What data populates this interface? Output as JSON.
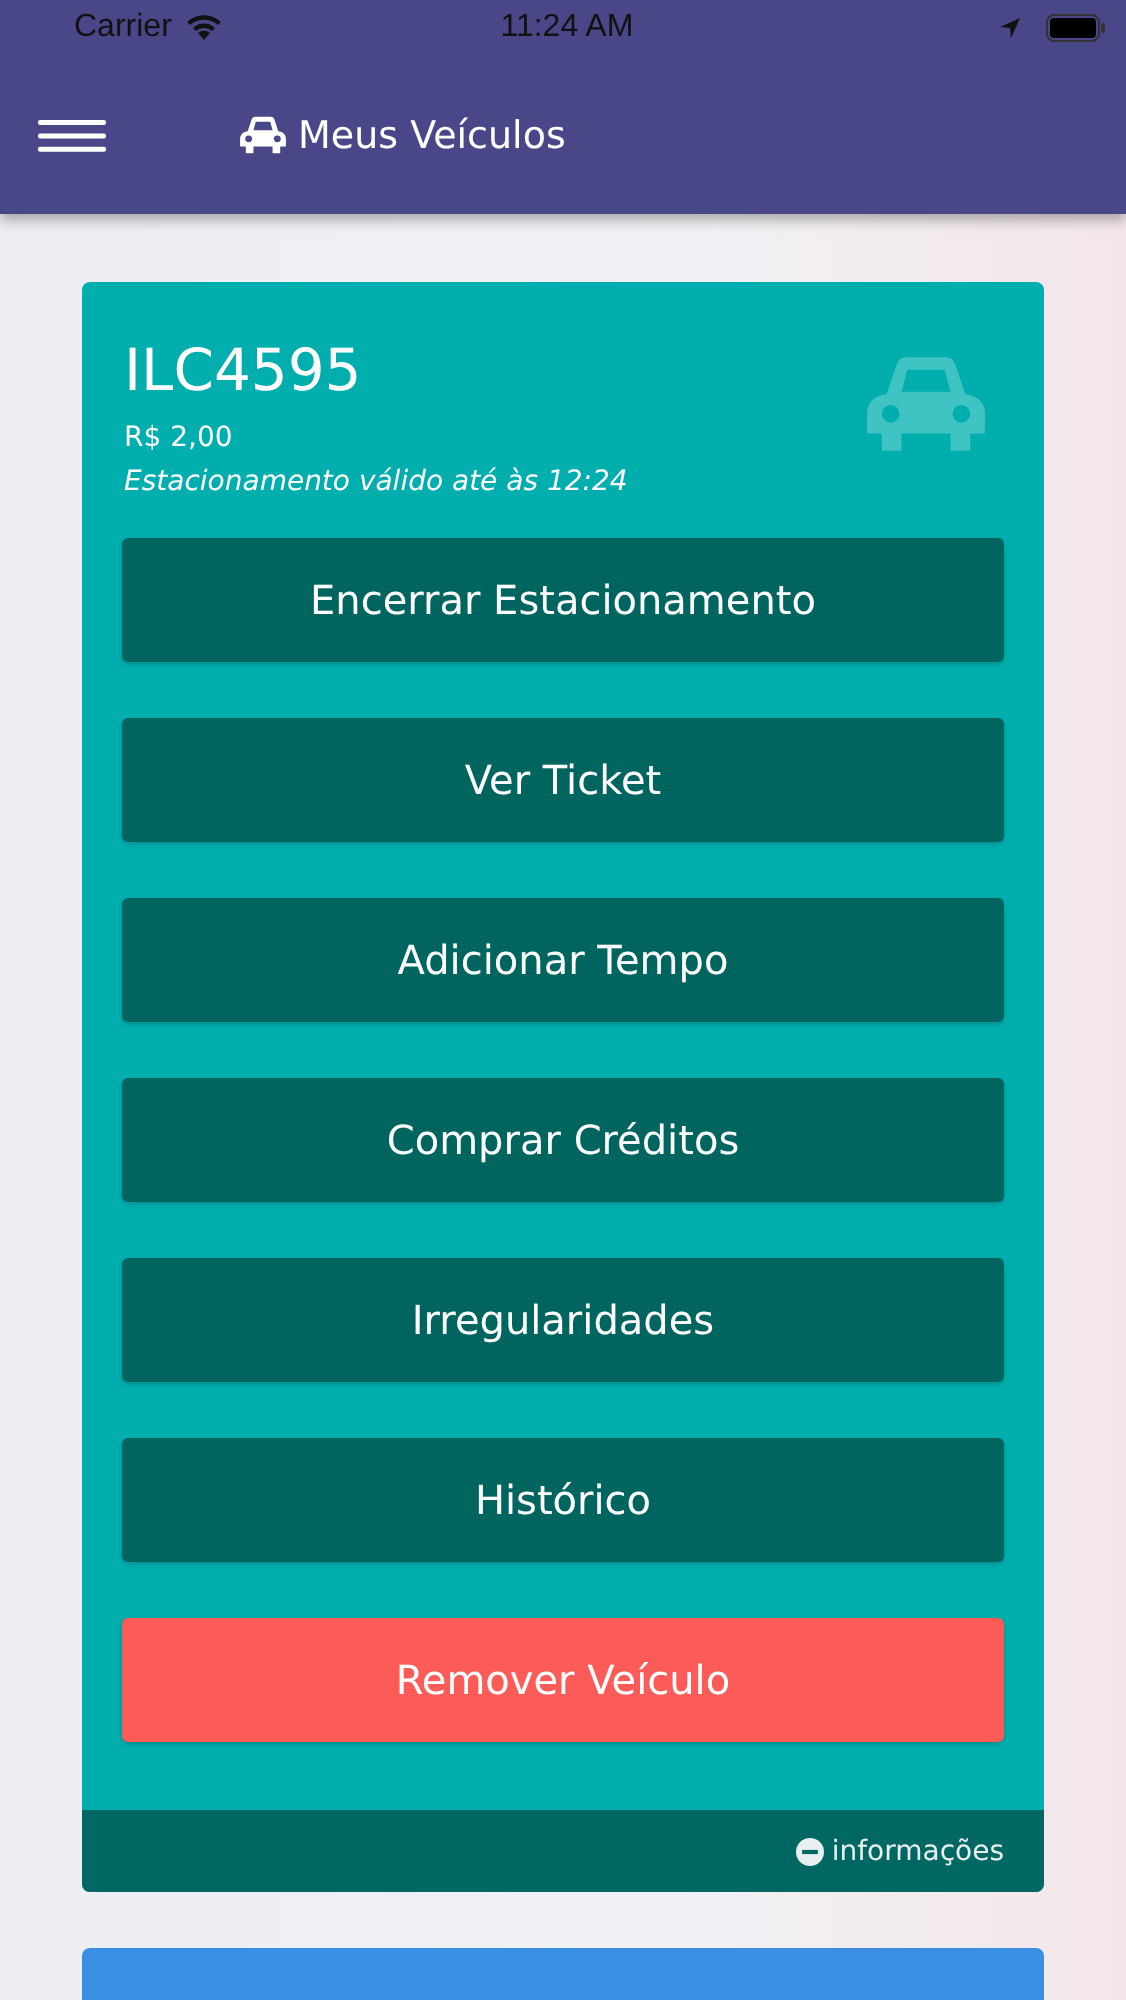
{
  "status_bar": {
    "carrier": "Carrier",
    "time": "11:24 AM"
  },
  "header": {
    "title": "Meus Veículos"
  },
  "vehicle": {
    "plate": "ILC4595",
    "price": "R$ 2,00",
    "validity": "Estacionamento válido até às 12:24",
    "actions": [
      {
        "label": "Encerrar Estacionamento",
        "kind": "normal"
      },
      {
        "label": "Ver Ticket",
        "kind": "normal"
      },
      {
        "label": "Adicionar Tempo",
        "kind": "normal"
      },
      {
        "label": "Comprar Créditos",
        "kind": "normal"
      },
      {
        "label": "Irregularidades",
        "kind": "normal"
      },
      {
        "label": "Histórico",
        "kind": "normal"
      },
      {
        "label": "Remover Veículo",
        "kind": "danger"
      }
    ],
    "info_link": "informações"
  }
}
